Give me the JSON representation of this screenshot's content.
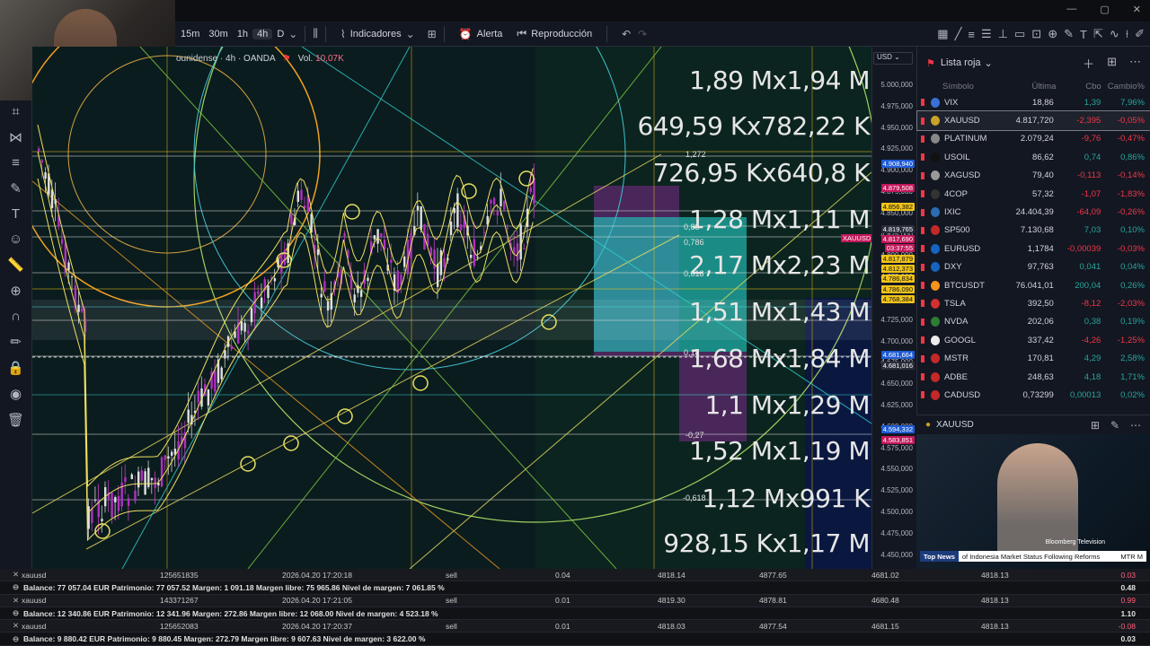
{
  "toolbar": {
    "timeframes": [
      "15m",
      "30m",
      "1h",
      "4h",
      "D"
    ],
    "active_timeframe": "4h",
    "indicators_label": "Indicadores",
    "alert_label": "Alerta",
    "replay_label": "Reproducción"
  },
  "chart": {
    "symbol_legend": "ounidense · 4h · OANDA",
    "volume_label": "Vol.",
    "volume_value": "10,07K",
    "currency": "USD",
    "big_labels": [
      "1,89 Mx1,94 M",
      "649,59 Kx782,22 K",
      "726,95 Kx640,8 K",
      "1,28 Mx1,11 M",
      "2,17 Mx2,23 M",
      "1,51 Mx1,43 M",
      "1,68 Mx1,84 M",
      "1,1 Mx1,29 M",
      "1,52 Mx1,19 M",
      "1,12 Mx991 K",
      "928,15 Kx1,17 M"
    ],
    "fib_labels": [
      "1,272",
      "0,88",
      "0,786",
      "0,618",
      "0,18",
      "-0,27",
      "-0,618"
    ],
    "price_ticks": [
      "5.000,000",
      "4.975,000",
      "4.950,000",
      "4.925,000",
      "4.900,000",
      "4.875,000",
      "4.850,000",
      "4.825,000",
      "4.800,000",
      "4.775,000",
      "4.750,000",
      "4.725,000",
      "4.700,000",
      "4.675,000",
      "4.650,000",
      "4.625,000",
      "4.600,000",
      "4.575,000",
      "4.550,000",
      "4.525,000",
      "4.500,000",
      "4.475,000",
      "4.450,000"
    ],
    "price_tags": [
      {
        "text": "4.908,940",
        "color": "#1e5bd6"
      },
      {
        "text": "4.879,508",
        "color": "#c2185b"
      },
      {
        "text": "4.856,382",
        "color": "#f0c419"
      },
      {
        "text": "4.819,765",
        "color": "#2a2e39"
      },
      {
        "text": "4.817,690",
        "color": "#c2185b"
      },
      {
        "text": "03:37:55",
        "color": "#c2185b"
      },
      {
        "text": "4.817,879",
        "color": "#f0c419"
      },
      {
        "text": "4.812,373",
        "color": "#f0c419"
      },
      {
        "text": "4.786,834",
        "color": "#f0c419"
      },
      {
        "text": "4.786,090",
        "color": "#f0c419"
      },
      {
        "text": "4.768,384",
        "color": "#f0c419"
      },
      {
        "text": "4.681,664",
        "color": "#1e5bd6"
      },
      {
        "text": "4.681,016",
        "color": "#2a2e39"
      },
      {
        "text": "4.594,332",
        "color": "#1e5bd6"
      },
      {
        "text": "4.583,851",
        "color": "#c2185b"
      }
    ],
    "xauusd_tag": "XAUUSD"
  },
  "watchlist": {
    "title": "Lista roja",
    "columns": {
      "symbol": "Símbolo",
      "last": "Última",
      "change": "Cbo",
      "pct": "Cambio%"
    },
    "rows": [
      {
        "sym": "VIX",
        "last": "18,86",
        "chg": "1,39",
        "pct": "7,96%",
        "dir": "pos",
        "logo": "#3a6fd8"
      },
      {
        "sym": "XAUUSD",
        "last": "4.817,720",
        "chg": "-2,395",
        "pct": "-0,05%",
        "dir": "neg",
        "logo": "#c9a227"
      },
      {
        "sym": "PLATINUM",
        "last": "2.079,24",
        "chg": "-9,76",
        "pct": "-0,47%",
        "dir": "neg",
        "logo": "#888"
      },
      {
        "sym": "USOIL",
        "last": "86,62",
        "chg": "0,74",
        "pct": "0,86%",
        "dir": "pos",
        "logo": "#111"
      },
      {
        "sym": "XAGUSD",
        "last": "79,40",
        "chg": "-0,113",
        "pct": "-0,14%",
        "dir": "neg",
        "logo": "#999"
      },
      {
        "sym": "4COP",
        "last": "57,32",
        "chg": "-1,07",
        "pct": "-1,83%",
        "dir": "neg",
        "logo": "#333"
      },
      {
        "sym": "IXIC",
        "last": "24.404,39",
        "chg": "-64,09",
        "pct": "-0,26%",
        "dir": "neg",
        "logo": "#2b6cb0"
      },
      {
        "sym": "SP500",
        "last": "7.130,68",
        "chg": "7,03",
        "pct": "0,10%",
        "dir": "pos",
        "logo": "#c62828"
      },
      {
        "sym": "EURUSD",
        "last": "1,1784",
        "chg": "-0,00039",
        "pct": "-0,03%",
        "dir": "neg",
        "logo": "#1565c0"
      },
      {
        "sym": "DXY",
        "last": "97,763",
        "chg": "0,041",
        "pct": "0,04%",
        "dir": "pos",
        "logo": "#1565c0"
      },
      {
        "sym": "BTCUSDT",
        "last": "76.041,01",
        "chg": "200,04",
        "pct": "0,26%",
        "dir": "pos",
        "logo": "#f7931a"
      },
      {
        "sym": "TSLA",
        "last": "392,50",
        "chg": "-8,12",
        "pct": "-2,03%",
        "dir": "neg",
        "logo": "#d32f2f"
      },
      {
        "sym": "NVDA",
        "last": "202,06",
        "chg": "0,38",
        "pct": "0,19%",
        "dir": "pos",
        "logo": "#2e7d32"
      },
      {
        "sym": "GOOGL",
        "last": "337,42",
        "chg": "-4,26",
        "pct": "-1,25%",
        "dir": "neg",
        "logo": "#eee"
      },
      {
        "sym": "MSTR",
        "last": "170,81",
        "chg": "4,29",
        "pct": "2,58%",
        "dir": "pos",
        "logo": "#c62828"
      },
      {
        "sym": "ADBE",
        "last": "248,63",
        "chg": "4,18",
        "pct": "1,71%",
        "dir": "pos",
        "logo": "#c62828"
      },
      {
        "sym": "CADUSD",
        "last": "0,73299",
        "chg": "0,00013",
        "pct": "0,02%",
        "dir": "pos",
        "logo": "#c62828"
      }
    ]
  },
  "detail": {
    "symbol": "XAUUSD"
  },
  "tv": {
    "ticker_label": "Top News",
    "ticker_text": "of Indonesia Market Status Following Reforms",
    "ticker_tail": "MTR M",
    "brand": "Bloomberg Television"
  },
  "positions": [
    {
      "sym": "xauusd",
      "id": "125651835",
      "time": "2026.04.20 17:20:18",
      "type": "sell",
      "vol": "0.04",
      "open": "4818.14",
      "sl": "4877.65",
      "tp": "4681.02",
      "price": "4818.13",
      "profit": "0.03",
      "pdir": "neg",
      "balance": "Balance: 77 057.04 EUR  Patrimonio: 77 057.52  Margen: 1 091.18  Margen libre: 75 965.86  Nivel de margen: 7 061.85 %",
      "btotal": "0.48"
    },
    {
      "sym": "xauusd",
      "id": "143371267",
      "time": "2026.04.20 17:21:05",
      "type": "sell",
      "vol": "0.01",
      "open": "4819.30",
      "sl": "4878.81",
      "tp": "4680.48",
      "price": "4818.13",
      "profit": "0.99",
      "pdir": "neg",
      "balance": "Balance: 12 340.86 EUR  Patrimonio: 12 341.96  Margen: 272.86  Margen libre: 12 068.00  Nivel de margen: 4 523.18 %",
      "btotal": "1.10"
    },
    {
      "sym": "xauusd",
      "id": "125652083",
      "time": "2026.04.20 17:20:37",
      "type": "sell",
      "vol": "0.01",
      "open": "4818.03",
      "sl": "4877.54",
      "tp": "4681.15",
      "price": "4818.13",
      "profit": "-0.08",
      "pdir": "neg",
      "balance": "Balance: 9 880.42 EUR  Patrimonio: 9 880.45  Margen: 272.79  Margen libre: 9 607.63  Nivel de margen: 3 622.00 %",
      "btotal": "0.03"
    }
  ]
}
